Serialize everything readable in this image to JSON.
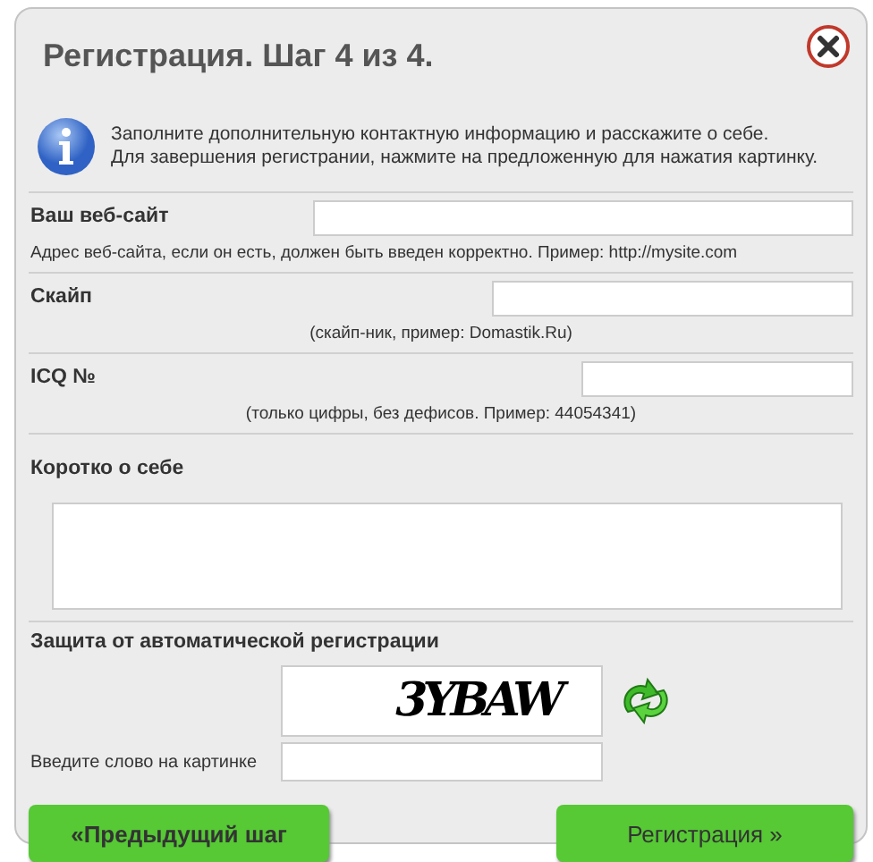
{
  "window": {
    "title": "Регистрация. Шаг 4 из 4."
  },
  "info": {
    "lines": [
      "Заполните дополнительную контактную информацию и расскажите о себе.",
      "Для завершения регистрании, нажмите на предложенную для нажатия картинку."
    ]
  },
  "fields": [
    {
      "kind": "input",
      "label": "Ваш веб-сайт",
      "hint": "Адрес веб-сайта, если он есть, должен быть введен корректно. Пример: http://mysite.com"
    },
    {
      "kind": "input",
      "label": "Скайп",
      "hint": "(скайп-ник, пример: Domastik.Ru)"
    },
    {
      "kind": "input",
      "label": "ICQ №",
      "hint": "(только цифры, без дефисов. Пример: 44054341)"
    },
    {
      "kind": "textarea",
      "label": "Коротко о себе"
    }
  ],
  "captcha": {
    "title": "Защита от автоматической регистрации",
    "image_text": "3YBAW",
    "input_label": "Введите слово на картинке"
  },
  "buttons": [
    {
      "label": "«Предыдущий шаг"
    },
    {
      "label": "Регистрация »"
    }
  ]
}
